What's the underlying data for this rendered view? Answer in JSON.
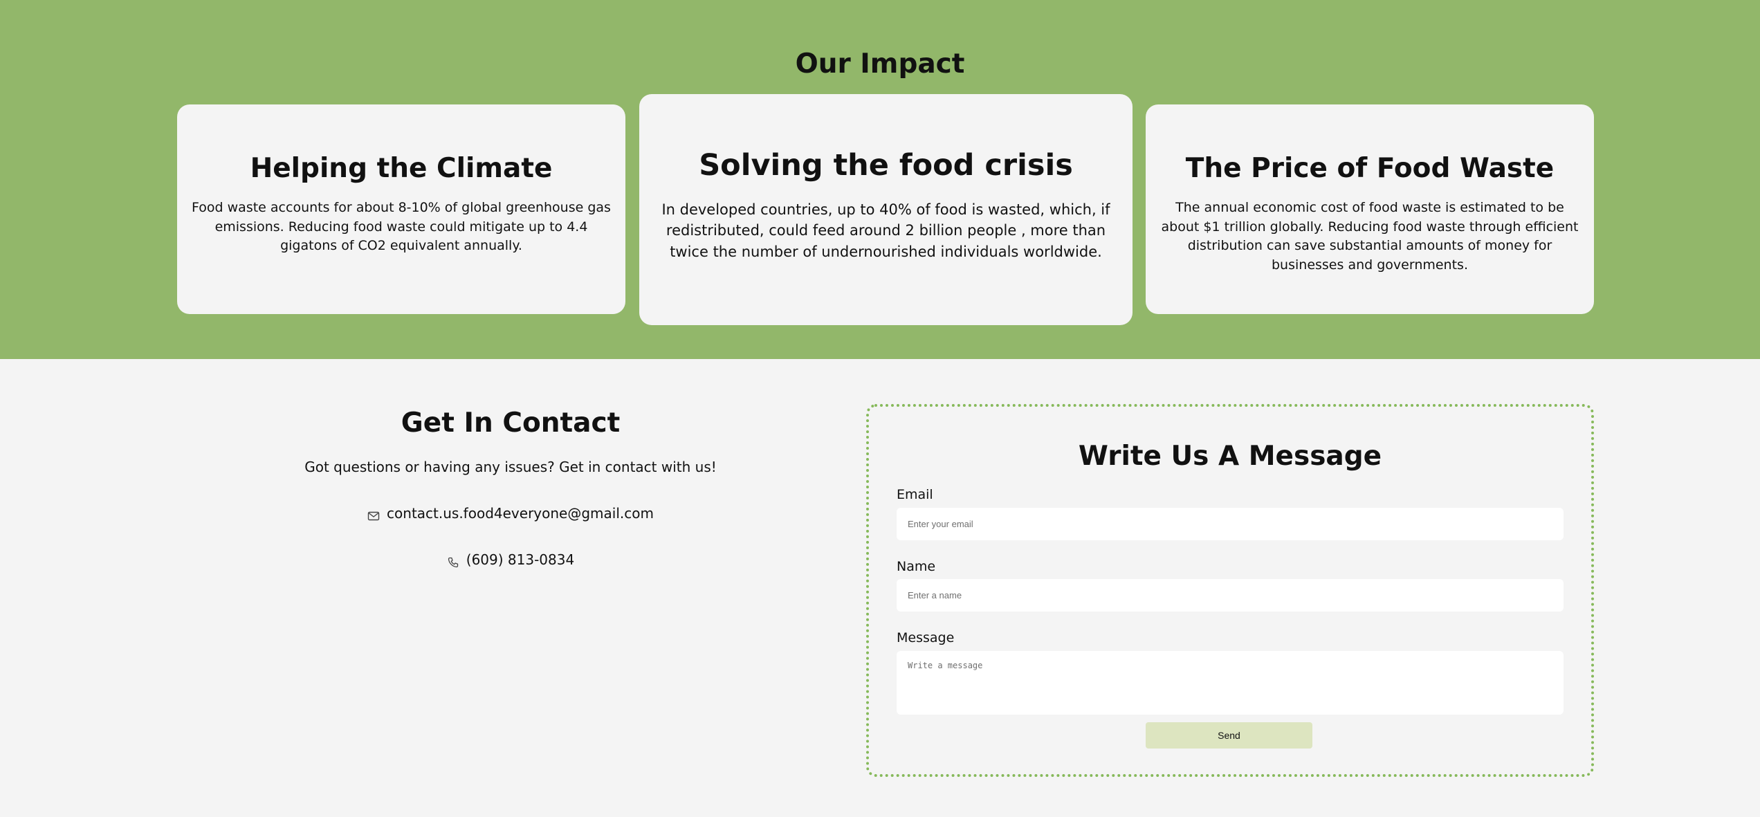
{
  "impact": {
    "title": "Our Impact",
    "cards": [
      {
        "title": "Helping the Climate",
        "text": "Food waste accounts for about 8-10% of global greenhouse gas emissions. Reducing food waste could mitigate up to 4.4 gigatons of CO2 equivalent annually."
      },
      {
        "title": "Solving the food crisis",
        "text": "In developed countries, up to 40% of food is wasted, which, if redistributed, could feed around 2 billion people , more than twice the number of undernourished individuals worldwide."
      },
      {
        "title": "The Price of Food Waste",
        "text": "The annual economic cost of food waste is estimated to be about $1 trillion globally. Reducing food waste through efficient distribution can save substantial amounts of money for businesses and governments."
      }
    ]
  },
  "contact": {
    "title": "Get In Contact",
    "subtitle": "Got questions or having any issues? Get in contact with us!",
    "email": "contact.us.food4everyone@gmail.com",
    "phone": "(609) 813-0834",
    "email_icon": "mail-icon",
    "phone_icon": "phone-icon"
  },
  "form": {
    "title": "Write Us A Message",
    "email_label": "Email",
    "email_placeholder": "Enter your email",
    "name_label": "Name",
    "name_placeholder": "Enter a name",
    "message_label": "Message",
    "message_placeholder": "Write a message",
    "send_label": "Send"
  },
  "colors": {
    "impact_background": "#92b76a",
    "page_background": "#f4f4f4",
    "form_border": "#86b95a",
    "send_button": "#dde5c0"
  }
}
